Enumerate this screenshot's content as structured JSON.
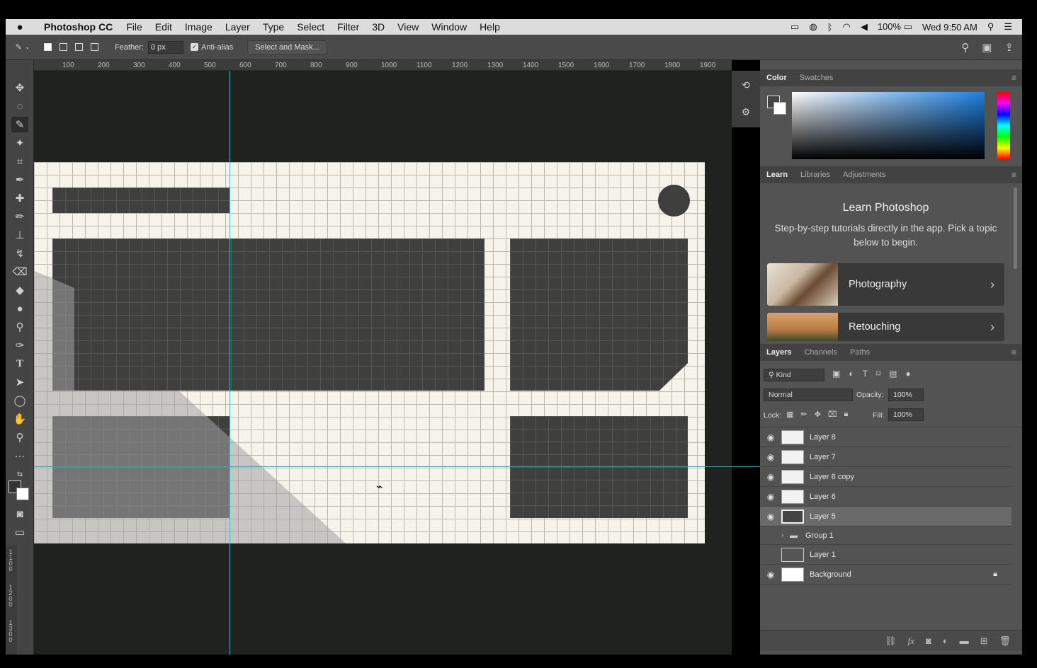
{
  "menubar": {
    "apple": "",
    "app": "Photoshop CC",
    "items": [
      "File",
      "Edit",
      "Image",
      "Layer",
      "Type",
      "Select",
      "Filter",
      "3D",
      "View",
      "Window",
      "Help"
    ],
    "battery": "100%",
    "clock": "Wed 9:50 AM"
  },
  "options": {
    "feather_label": "Feather:",
    "feather_value": "0 px",
    "antialias_label": "Anti-alias",
    "select_mask_label": "Select and Mask..."
  },
  "ruler": {
    "h_ticks": [
      "100",
      "200",
      "300",
      "400",
      "500",
      "600",
      "700",
      "800",
      "900",
      "1000",
      "1100",
      "1200",
      "1300",
      "1400",
      "1500",
      "1600",
      "1700",
      "1800",
      "1900"
    ],
    "v_ticks": [
      "1\n1\n0\n0",
      "1\n2\n0\n0",
      "1\n3\n0\n0"
    ]
  },
  "color_panel": {
    "tabs": [
      "Color",
      "Swatches"
    ]
  },
  "learn_panel": {
    "tabs": [
      "Learn",
      "Libraries",
      "Adjustments"
    ],
    "title": "Learn Photoshop",
    "subtitle": "Step-by-step tutorials directly in the app. Pick a topic below to begin.",
    "cards": [
      "Photography",
      "Retouching"
    ]
  },
  "layers_panel": {
    "tabs": [
      "Layers",
      "Channels",
      "Paths"
    ],
    "kind_label": "Kind",
    "blend_mode": "Normal",
    "opacity_label": "Opacity:",
    "opacity_value": "100%",
    "lock_label": "Lock:",
    "fill_label": "Fill:",
    "fill_value": "100%",
    "layers": [
      {
        "name": "Layer 8",
        "visible": true,
        "selected": false
      },
      {
        "name": "Layer 7",
        "visible": true,
        "selected": false
      },
      {
        "name": "Layer 6 copy",
        "visible": true,
        "selected": false
      },
      {
        "name": "Layer 6",
        "visible": true,
        "selected": false
      },
      {
        "name": "Layer 5",
        "visible": true,
        "selected": true
      },
      {
        "name": "Group 1",
        "visible": false,
        "selected": false
      },
      {
        "name": "Layer 1",
        "visible": false,
        "selected": false
      },
      {
        "name": "Background",
        "visible": true,
        "selected": false
      }
    ]
  }
}
